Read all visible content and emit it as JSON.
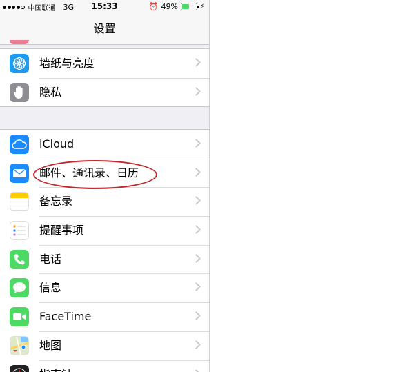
{
  "status_bar": {
    "carrier": "中国联通",
    "network": "3G",
    "time": "15:33",
    "battery_percent": "49%",
    "battery_level": 0.49,
    "battery_color": "#4cd964"
  },
  "nav": {
    "title": "设置"
  },
  "group1": {
    "items": [
      {
        "label": "墙纸与亮度",
        "icon": "wallpaper-flower-icon",
        "color": "#1d9bf0"
      },
      {
        "label": "隐私",
        "icon": "privacy-hand-icon",
        "color": "#8e8e93"
      }
    ]
  },
  "group2": {
    "items": [
      {
        "label": "iCloud",
        "icon": "icloud-icon",
        "color": "#1a8cff"
      },
      {
        "label": "邮件、通讯录、日历",
        "icon": "mail-envelope-icon",
        "color": "#1a8cff"
      },
      {
        "label": "备忘录",
        "icon": "notes-icon",
        "color": "#ffcc00"
      },
      {
        "label": "提醒事项",
        "icon": "reminders-icon",
        "color": "#ffffff"
      },
      {
        "label": "电话",
        "icon": "phone-icon",
        "color": "#4cd964"
      },
      {
        "label": "信息",
        "icon": "messages-icon",
        "color": "#4cd964"
      },
      {
        "label": "FaceTime",
        "icon": "facetime-camera-icon",
        "color": "#4cd964"
      },
      {
        "label": "地图",
        "icon": "maps-icon",
        "color": "#7fc6ff"
      },
      {
        "label": "指南针",
        "icon": "compass-icon",
        "color": "#222222"
      }
    ]
  },
  "annotation": {
    "color": "#c0282d"
  }
}
